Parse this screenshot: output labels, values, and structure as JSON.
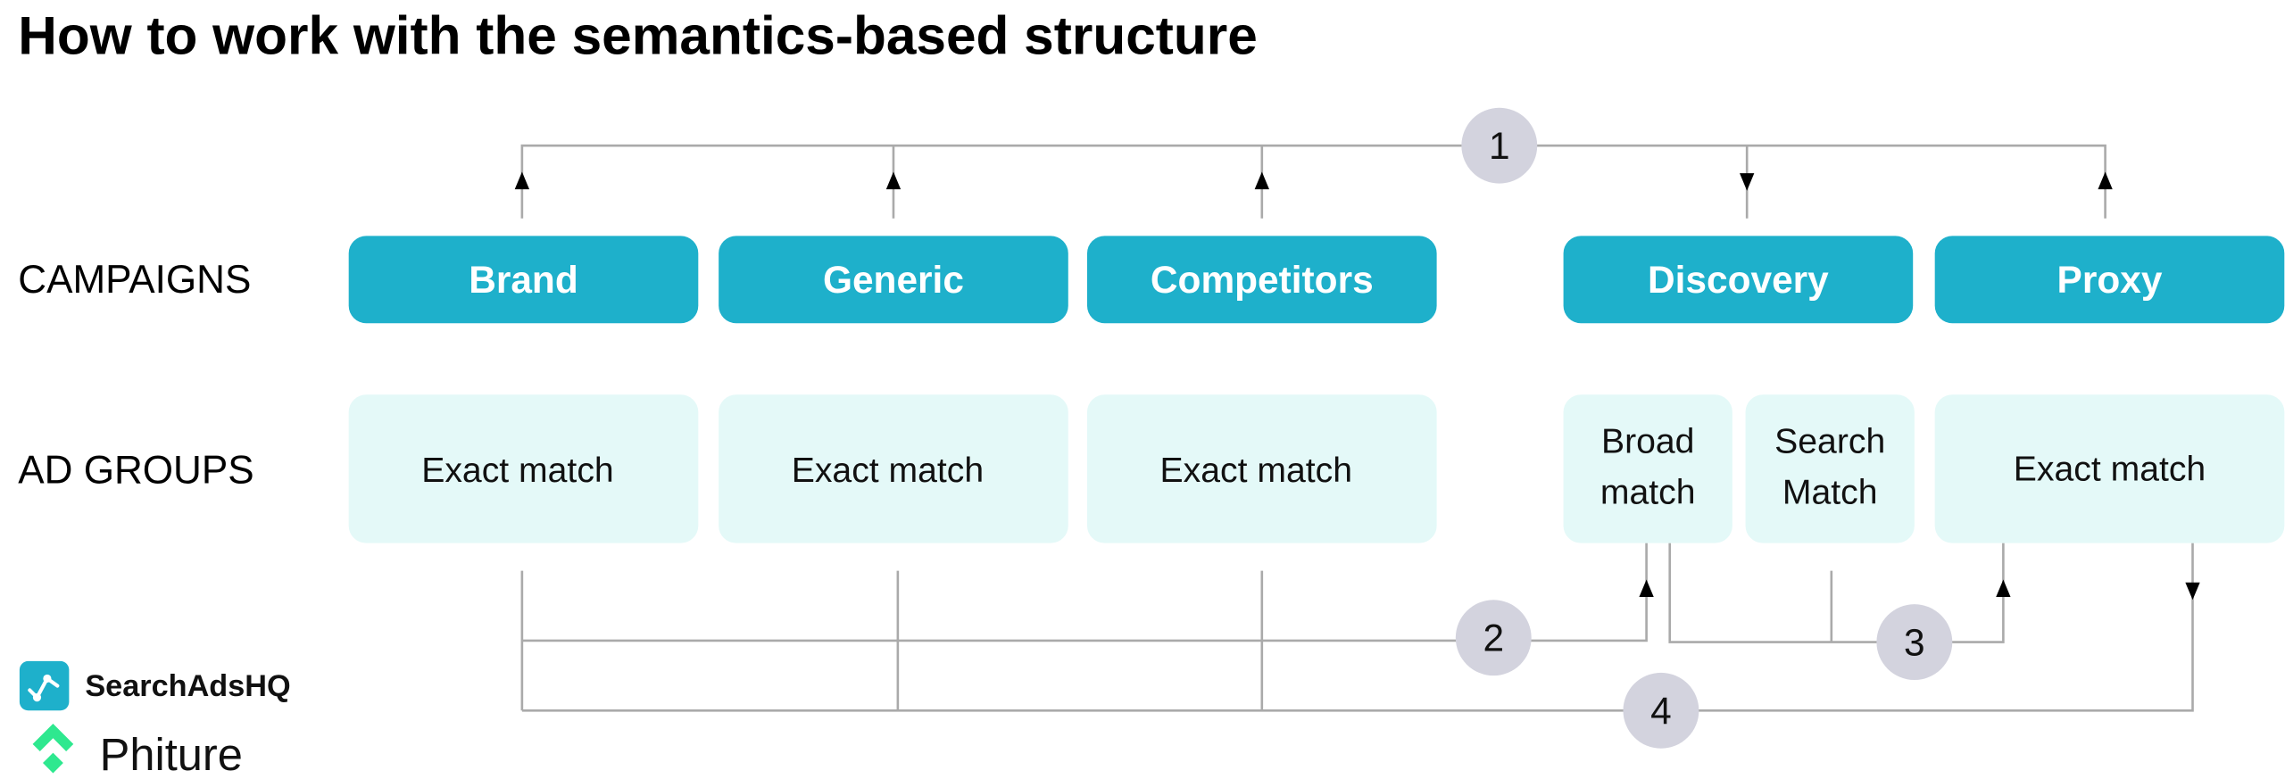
{
  "title": "How to work with the semantics-based structure",
  "row_labels": {
    "campaigns": "CAMPAIGNS",
    "ad_groups": "AD GROUPS"
  },
  "campaigns": [
    "Brand",
    "Generic",
    "Competitors",
    "Discovery",
    "Proxy"
  ],
  "ad_groups": {
    "brand": "Exact match",
    "generic": "Exact match",
    "competitors": "Exact match",
    "discovery_broad_1": "Broad",
    "discovery_broad_2": "match",
    "discovery_search_1": "Search",
    "discovery_search_2": "Match",
    "proxy": "Exact match"
  },
  "steps": [
    "1",
    "2",
    "3",
    "4"
  ],
  "logos": {
    "searchadshq": "SearchAdsHQ",
    "phiture": "Phiture"
  },
  "colors": {
    "campaign": "#1eb0cb",
    "ad_group": "#e4f9f8",
    "badge": "#d3d3de",
    "connector": "#aaaaaa",
    "phiture_green": "#2ee88f"
  }
}
